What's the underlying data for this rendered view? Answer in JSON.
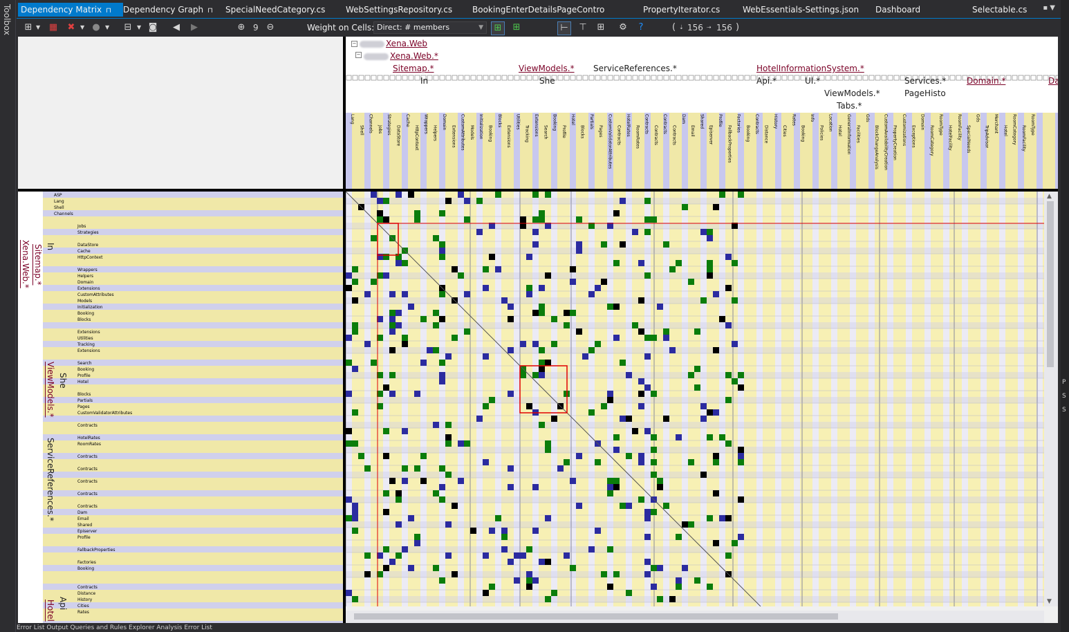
{
  "toolbox": {
    "label": "Toolbox"
  },
  "tabs": [
    {
      "label": "Dependency Matrix",
      "active": true,
      "pinned": true
    },
    {
      "label": "Dependency Graph",
      "active": false,
      "pinned": true
    },
    {
      "label": "SpecialNeedCategory.cs"
    },
    {
      "label": "WebSettingsRepository.cs"
    },
    {
      "label": "BookingEnterDetailsPageController.cs",
      "closable": true
    },
    {
      "label": "PropertyIterator.cs"
    },
    {
      "label": "WebEssentials-Settings.json"
    },
    {
      "label": "Dashboard"
    },
    {
      "label": "Selectable.cs"
    }
  ],
  "toolbar": {
    "zoom_level": "9",
    "weight_label": "Weight on Cells:",
    "weight_value": "Direct: # members",
    "count_open": "(",
    "count_row": "156",
    "count_col": "156",
    "count_close": ")"
  },
  "colors": {
    "green": "#0b7d0b",
    "blue": "#2b2ba0",
    "black": "#000000",
    "red": "#e00000",
    "yellow": "#f7f0b4",
    "lavender": "#d0d0ec"
  },
  "column_header": {
    "root": "Xena.Web",
    "sub": "Xena.Web.*",
    "namespaces": [
      "Sitemap.*",
      "ViewModels.*",
      "ServiceReferences.*",
      "HotelInformationSystem.*"
    ],
    "third_row": [
      "In",
      "She",
      "Api.*",
      "UI.*",
      "Services.*",
      "Domain.*",
      "Da"
    ],
    "fourth_row": [
      "ViewModels.*",
      "PageHisto",
      "Tabs.*"
    ],
    "leaf_labels": [
      "Lang",
      "Shell",
      "Channels",
      "Jobs",
      "Strategies",
      "DataStore",
      "Cache",
      "HttpContext",
      "Wrappers",
      "Helpers",
      "Domain",
      "Extensions",
      "CustomAttributes",
      "Models",
      "Initialization",
      "Booking",
      "Blocks",
      "Extensions",
      "Utilities",
      "Tracking",
      "Extensions",
      "Search",
      "Booking",
      "Profile",
      "Hotel",
      "Blocks",
      "Partials",
      "Pages",
      "CustomValidatorAttributes",
      "Contracts",
      "HotelRates",
      "RoomRates",
      "Contracts",
      "Contracts",
      "Contracts",
      "Contracts",
      "Dam",
      "Email",
      "Shared",
      "Episerver",
      "Profile",
      "FallbackProperties",
      "Factories",
      "Booking",
      "Contracts",
      "Distance",
      "History",
      "Cities",
      "Rates",
      "Booking",
      "Info",
      "Policies",
      "Location",
      "Hotel",
      "GeneralInformation",
      "Facilities",
      "Gds",
      "BlockChangeAnalysis",
      "CustomAvailabilityCreation",
      "PropertyCreation",
      "Customizations",
      "Exceptions",
      "Domain",
      "RoomCategory",
      "RoomType",
      "HotelFacility",
      "RoomFacility",
      "SpecialNeeds",
      "Gds",
      "TripAdvisor",
      "Merchant",
      "Hotel",
      "RoomCategory",
      "RoomFacility",
      "RoomType"
    ]
  },
  "row_header": {
    "rotated": [
      "Xena.Web.*",
      "Sitemap.*",
      "In",
      "ViewModels.*",
      "She",
      "ServiceReferences.*",
      "Api",
      "Hotel"
    ],
    "rows": [
      "ASP",
      "Lang",
      "Shell",
      "Channels",
      "",
      "Jobs",
      "Strategies",
      "",
      "DataStore",
      "Cache",
      "HttpContext",
      "",
      "Wrappers",
      "Helpers",
      "Domain",
      "Extensions",
      "CustomAttributes",
      "Models",
      "Initialization",
      "Booking",
      "Blocks",
      "",
      "Extensions",
      "Utilities",
      "Tracking",
      "Extensions",
      "",
      "Search",
      "Booking",
      "Profile",
      "Hotel",
      "",
      "Blocks",
      "Partials",
      "Pages",
      "CustomValidatorAttributes",
      "",
      "Contracts",
      "",
      "HotelRates",
      "RoomRates",
      "",
      "Contracts",
      "",
      "Contracts",
      "",
      "Contracts",
      "",
      "Contracts",
      "",
      "Contracts",
      "Dam",
      "Email",
      "Shared",
      "Episerver",
      "Profile",
      "",
      "FallbackProperties",
      "",
      "Factories",
      "Booking",
      "",
      "",
      "Contracts",
      "Distance",
      "History",
      "Cities",
      "Rates"
    ]
  },
  "status": {
    "text": "Error List   Output   Queries and Rules Explorer   Analysis Error List"
  }
}
